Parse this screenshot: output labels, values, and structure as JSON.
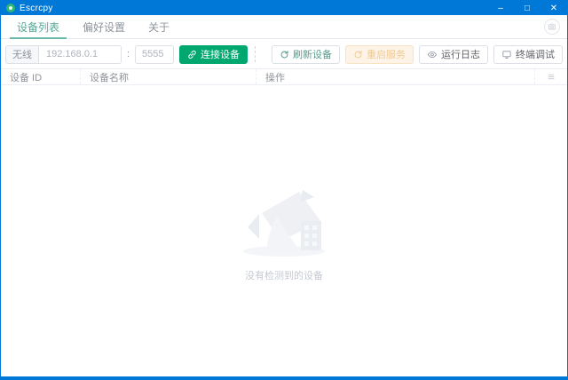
{
  "window": {
    "title": "Escrcpy",
    "minimize_glyph": "–",
    "maximize_glyph": "□",
    "close_glyph": "✕"
  },
  "tabbar": {
    "tabs": [
      {
        "label": "设备列表",
        "active": true
      },
      {
        "label": "偏好设置",
        "active": false
      },
      {
        "label": "关于",
        "active": false
      }
    ]
  },
  "toolbar": {
    "mode_label": "无线",
    "ip_placeholder": "192.168.0.1",
    "separator": ":",
    "port_placeholder": "5555",
    "connect_label": "连接设备",
    "refresh_label": "刷新设备",
    "restart_label": "重启服务",
    "logs_label": "运行日志",
    "terminal_label": "终端调试"
  },
  "device_table": {
    "columns": [
      "设备 ID",
      "设备名称",
      "操作"
    ],
    "rows": [],
    "empty_text": "没有检测到的设备"
  },
  "colors": {
    "titlebar_blue": "#0078d7",
    "primary_green": "#00a870",
    "active_tab_teal": "#53a896",
    "warning_disabled_bg": "#fdf3e7",
    "warning_disabled_text": "#eecb96",
    "header_text_gray": "#909399"
  }
}
